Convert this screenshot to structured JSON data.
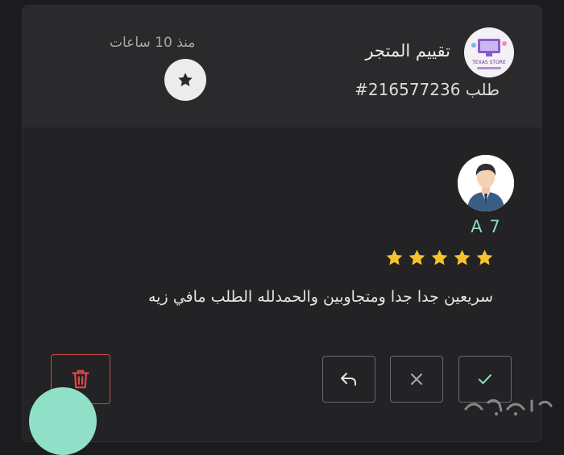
{
  "header": {
    "title": "تقييم المتجر",
    "order_number": "طلب 216577236#",
    "time_ago": "منذ 10 ساعات",
    "type_badge_icon": "star-icon",
    "store_logo_text": "TEXAS STORE"
  },
  "review": {
    "reviewer_name": "A 7",
    "rating": 5,
    "rating_max": 5,
    "text": "سريعين جدا جدا ومتجاوبين والحمدلله الطلب مافي زيه"
  },
  "actions": {
    "delete_icon": "trash-icon",
    "reply_icon": "reply-icon",
    "reject_icon": "close-icon",
    "approve_icon": "check-icon"
  },
  "colors": {
    "accent": "#8fd9c2",
    "star": "#f5c12e",
    "danger": "#e04a4a",
    "fab": "#8fe0c6"
  }
}
